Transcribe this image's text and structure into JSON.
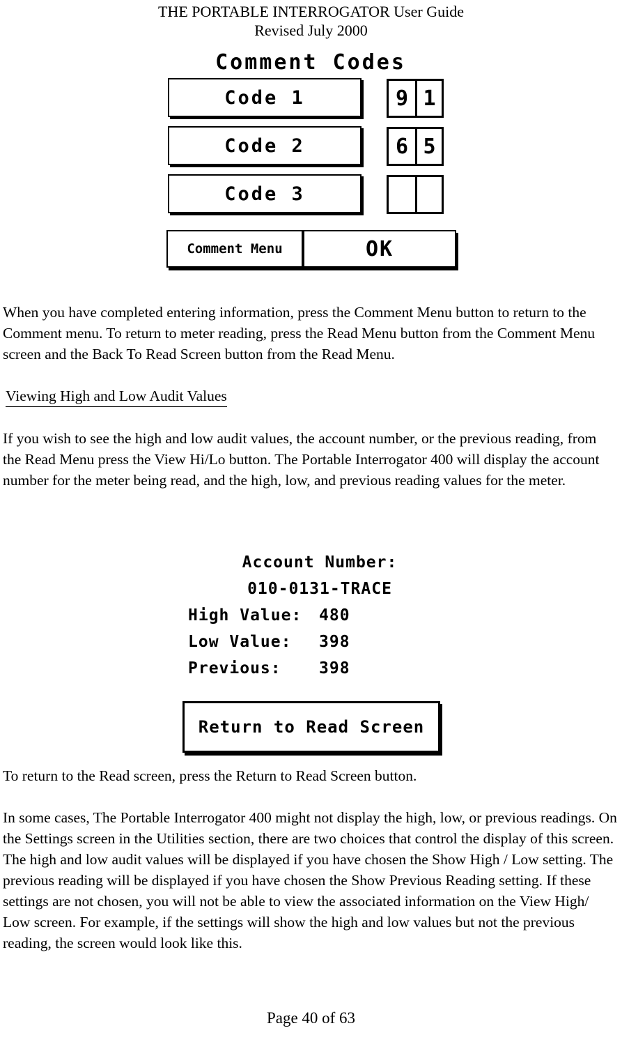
{
  "header": {
    "title": "THE PORTABLE INTERROGATOR User Guide",
    "revision": "Revised July 2000"
  },
  "lcd_comment_codes": {
    "title": "Comment Codes",
    "rows": [
      {
        "button_label": "Code 1",
        "digit1": "9",
        "digit2": "1"
      },
      {
        "button_label": "Code 2",
        "digit1": "6",
        "digit2": "5"
      },
      {
        "button_label": "Code 3",
        "digit1": "",
        "digit2": ""
      }
    ],
    "comment_menu_label": "Comment Menu",
    "ok_label": "OK"
  },
  "paragraph_1": "When you have completed entering information, press the Comment Menu button to return to the Comment menu.  To return to meter reading, press the Read Menu button from the Comment Menu screen and the Back To Read Screen button from the Read Menu.",
  "section_heading": "Viewing High and Low Audit Values",
  "paragraph_2": "If you wish to see the high and low audit values, the account number, or the previous reading, from the Read Menu press the View Hi/Lo button.  The Portable Interrogator 400 will display the account number for the meter being read, and the high, low, and previous reading values for the meter.",
  "lcd_hilo": {
    "account_label": "Account Number:",
    "account_value": "010-0131-TRACE",
    "rows": [
      {
        "label": "High Value:",
        "value": "480"
      },
      {
        "label": "Low Value:",
        "value": "398"
      },
      {
        "label": "Previous:",
        "value": "398"
      }
    ],
    "return_label": "Return to Read Screen"
  },
  "paragraph_3": "To return to the Read screen, press the Return to Read Screen button.",
  "paragraph_4": "In some cases, The Portable Interrogator 400 might not display the high, low, or previous readings.  On the Settings screen in the Utilities section, there are two choices that control the display of this screen.  The high and low audit values will be displayed if you have chosen the Show High / Low setting.  The previous reading will be displayed if you have chosen the Show Previous Reading setting.  If these settings are not chosen, you will not be able to view the associated information on the View High/ Low screen.  For example, if the settings will show the high and low values but not the previous reading, the screen would look like this.",
  "footer": {
    "page_label": "Page 40 of 63"
  }
}
